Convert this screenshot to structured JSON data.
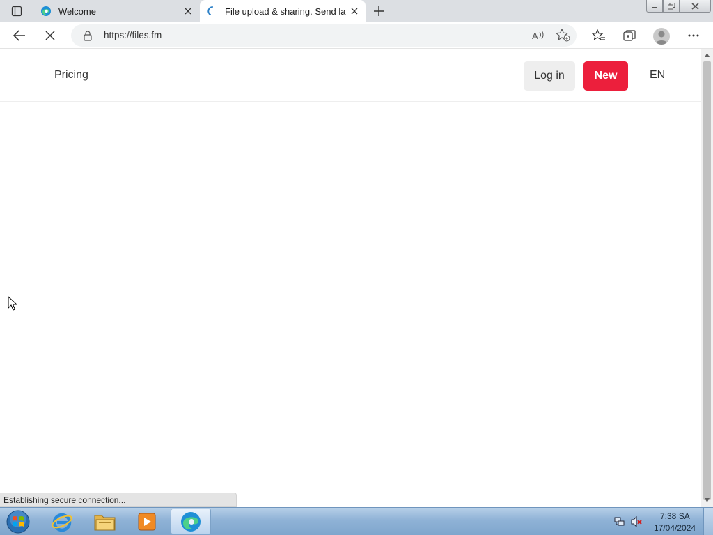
{
  "browser": {
    "tabs": [
      {
        "title": "Welcome",
        "active": false
      },
      {
        "title": "File upload & sharing. Send large files",
        "active": true
      }
    ],
    "address": {
      "url": "https://files.fm"
    }
  },
  "site": {
    "nav": {
      "pricing": "Pricing"
    },
    "buttons": {
      "login": "Log in",
      "new": "New"
    },
    "language": "EN",
    "colors": {
      "accent": "#ec1f3c",
      "login_bg": "#eeeeee"
    }
  },
  "status": {
    "text": "Establishing secure connection..."
  },
  "taskbar": {
    "apps": [
      "start-orb",
      "internet-explorer-icon",
      "file-explorer-icon",
      "media-player-icon",
      "edge-icon"
    ],
    "clock": {
      "time": "7:38 SA",
      "date": "17/04/2024"
    }
  }
}
